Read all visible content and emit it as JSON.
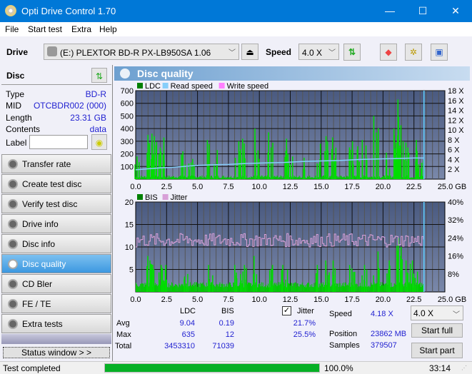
{
  "window": {
    "title": "Opti Drive Control 1.70",
    "minimize": "—",
    "maximize": "☐",
    "close": "✕"
  },
  "menu": [
    "File",
    "Start test",
    "Extra",
    "Help"
  ],
  "toolbar": {
    "drive_label": "Drive",
    "drive_value": "(E:)  PLEXTOR BD-R  PX-LB950SA 1.06",
    "speed_label": "Speed",
    "speed_value": "4.0 X"
  },
  "disc": {
    "title": "Disc",
    "rows": [
      {
        "k": "Type",
        "v": "BD-R"
      },
      {
        "k": "MID",
        "v": "OTCBDR002 (000)"
      },
      {
        "k": "Length",
        "v": "23.31 GB"
      },
      {
        "k": "Contents",
        "v": "data"
      }
    ],
    "label_key": "Label",
    "label_value": ""
  },
  "nav": [
    {
      "label": "Transfer rate"
    },
    {
      "label": "Create test disc"
    },
    {
      "label": "Verify test disc"
    },
    {
      "label": "Drive info"
    },
    {
      "label": "Disc info"
    },
    {
      "label": "Disc quality",
      "active": true
    },
    {
      "label": "CD Bler"
    },
    {
      "label": "FE / TE"
    },
    {
      "label": "Extra tests"
    }
  ],
  "status_window_btn": "Status window > >",
  "panel_title": "Disc quality",
  "chart_data": [
    {
      "type": "bar",
      "title": "LDC / Read speed",
      "legend": [
        "LDC",
        "Read speed",
        "Write speed"
      ],
      "legend_colors": [
        "#008000",
        "#87cefa",
        "#ff80ff"
      ],
      "x_ticks": [
        "0.0",
        "2.5",
        "5.0",
        "7.5",
        "10.0",
        "12.5",
        "15.0",
        "17.5",
        "20.0",
        "22.5",
        "25.0 GB"
      ],
      "xlim": [
        0,
        25
      ],
      "y_ticks": [
        "100",
        "200",
        "300",
        "400",
        "500",
        "600",
        "700"
      ],
      "ylim": [
        0,
        700
      ],
      "y2_ticks": [
        "2 X",
        "4 X",
        "6 X",
        "8 X",
        "10 X",
        "12 X",
        "14 X",
        "16 X",
        "18 X"
      ],
      "y2lim": [
        0,
        18
      ],
      "ldc_peaks": [
        [
          0.1,
          180
        ],
        [
          1.1,
          350
        ],
        [
          1.3,
          360
        ],
        [
          1.5,
          340
        ],
        [
          2.0,
          250
        ],
        [
          2.2,
          330
        ],
        [
          3.9,
          220
        ],
        [
          4.5,
          160
        ],
        [
          6.0,
          310
        ],
        [
          6.5,
          230
        ],
        [
          8.2,
          300
        ],
        [
          8.6,
          320
        ],
        [
          9.7,
          400
        ],
        [
          10.8,
          370
        ],
        [
          12.0,
          320
        ],
        [
          12.5,
          200
        ],
        [
          13.7,
          170
        ],
        [
          14.8,
          280
        ],
        [
          15.3,
          340
        ],
        [
          16.0,
          330
        ],
        [
          17.3,
          300
        ],
        [
          17.8,
          260
        ],
        [
          18.5,
          310
        ],
        [
          19.4,
          500
        ],
        [
          20.4,
          210
        ],
        [
          21.2,
          630
        ],
        [
          21.0,
          400
        ],
        [
          21.5,
          300
        ],
        [
          22.0,
          290
        ],
        [
          22.5,
          310
        ],
        [
          23.0,
          150
        ]
      ],
      "read_speed": [
        [
          0,
          1.9
        ],
        [
          1.0,
          2.1
        ],
        [
          2.0,
          2.3
        ],
        [
          3.0,
          2.4
        ],
        [
          4.0,
          2.6
        ],
        [
          5.0,
          2.8
        ],
        [
          6.0,
          2.9
        ],
        [
          7.5,
          3.0
        ],
        [
          9.0,
          3.2
        ],
        [
          10.5,
          3.3
        ],
        [
          12.0,
          3.4
        ],
        [
          13.5,
          3.6
        ],
        [
          15.0,
          3.7
        ],
        [
          16.5,
          3.8
        ],
        [
          18.0,
          4.0
        ],
        [
          19.5,
          4.1
        ],
        [
          21.0,
          4.2
        ],
        [
          22.5,
          4.3
        ],
        [
          23.3,
          4.3
        ]
      ],
      "end_marker": 23.31
    },
    {
      "type": "bar",
      "title": "BIS / Jitter",
      "legend": [
        "BIS",
        "Jitter"
      ],
      "legend_colors": [
        "#008000",
        "#d8a0d8"
      ],
      "x_ticks": [
        "0.0",
        "2.5",
        "5.0",
        "7.5",
        "10.0",
        "12.5",
        "15.0",
        "17.5",
        "20.0",
        "22.5",
        "25.0 GB"
      ],
      "xlim": [
        0,
        25
      ],
      "y_ticks": [
        "5",
        "10",
        "15",
        "20"
      ],
      "ylim": [
        0,
        20
      ],
      "y2_ticks": [
        "8%",
        "16%",
        "24%",
        "32%",
        "40%"
      ],
      "y2lim": [
        0,
        40
      ],
      "bis_peaks": [
        [
          1.1,
          8
        ],
        [
          1.3,
          7
        ],
        [
          2.0,
          6
        ],
        [
          2.3,
          6
        ],
        [
          4.0,
          4
        ],
        [
          6.0,
          6
        ],
        [
          8.2,
          6
        ],
        [
          8.7,
          6
        ],
        [
          9.7,
          8
        ],
        [
          10.8,
          6
        ],
        [
          12.0,
          6
        ],
        [
          14.8,
          6
        ],
        [
          15.5,
          7
        ],
        [
          16.0,
          7
        ],
        [
          17.5,
          6
        ],
        [
          18.5,
          6
        ],
        [
          19.4,
          9
        ],
        [
          20.5,
          7
        ],
        [
          21.2,
          12
        ],
        [
          21.5,
          10
        ],
        [
          22.0,
          7
        ],
        [
          22.5,
          7
        ]
      ],
      "jitter_avg": 21.7,
      "jitter_band": [
        20,
        26
      ],
      "end_marker": 23.31
    }
  ],
  "stats": {
    "col_ldc": "LDC",
    "col_bis": "BIS",
    "jitter_label": "Jitter",
    "jitter_checked": true,
    "rows": [
      {
        "k": "Avg",
        "ldc": "9.04",
        "bis": "0.19",
        "jit": "21.7%"
      },
      {
        "k": "Max",
        "ldc": "635",
        "bis": "12",
        "jit": "25.5%"
      },
      {
        "k": "Total",
        "ldc": "3453310",
        "bis": "71039",
        "jit": ""
      }
    ],
    "speed_label": "Speed",
    "speed_value": "4.18 X",
    "position_label": "Position",
    "position_value": "23862 MB",
    "samples_label": "Samples",
    "samples_value": "379507",
    "speed_select": "4.0 X",
    "start_full": "Start full",
    "start_part": "Start part"
  },
  "status": {
    "text": "Test completed",
    "progress": 100.0,
    "progress_text": "100.0%",
    "time": "33:14"
  }
}
